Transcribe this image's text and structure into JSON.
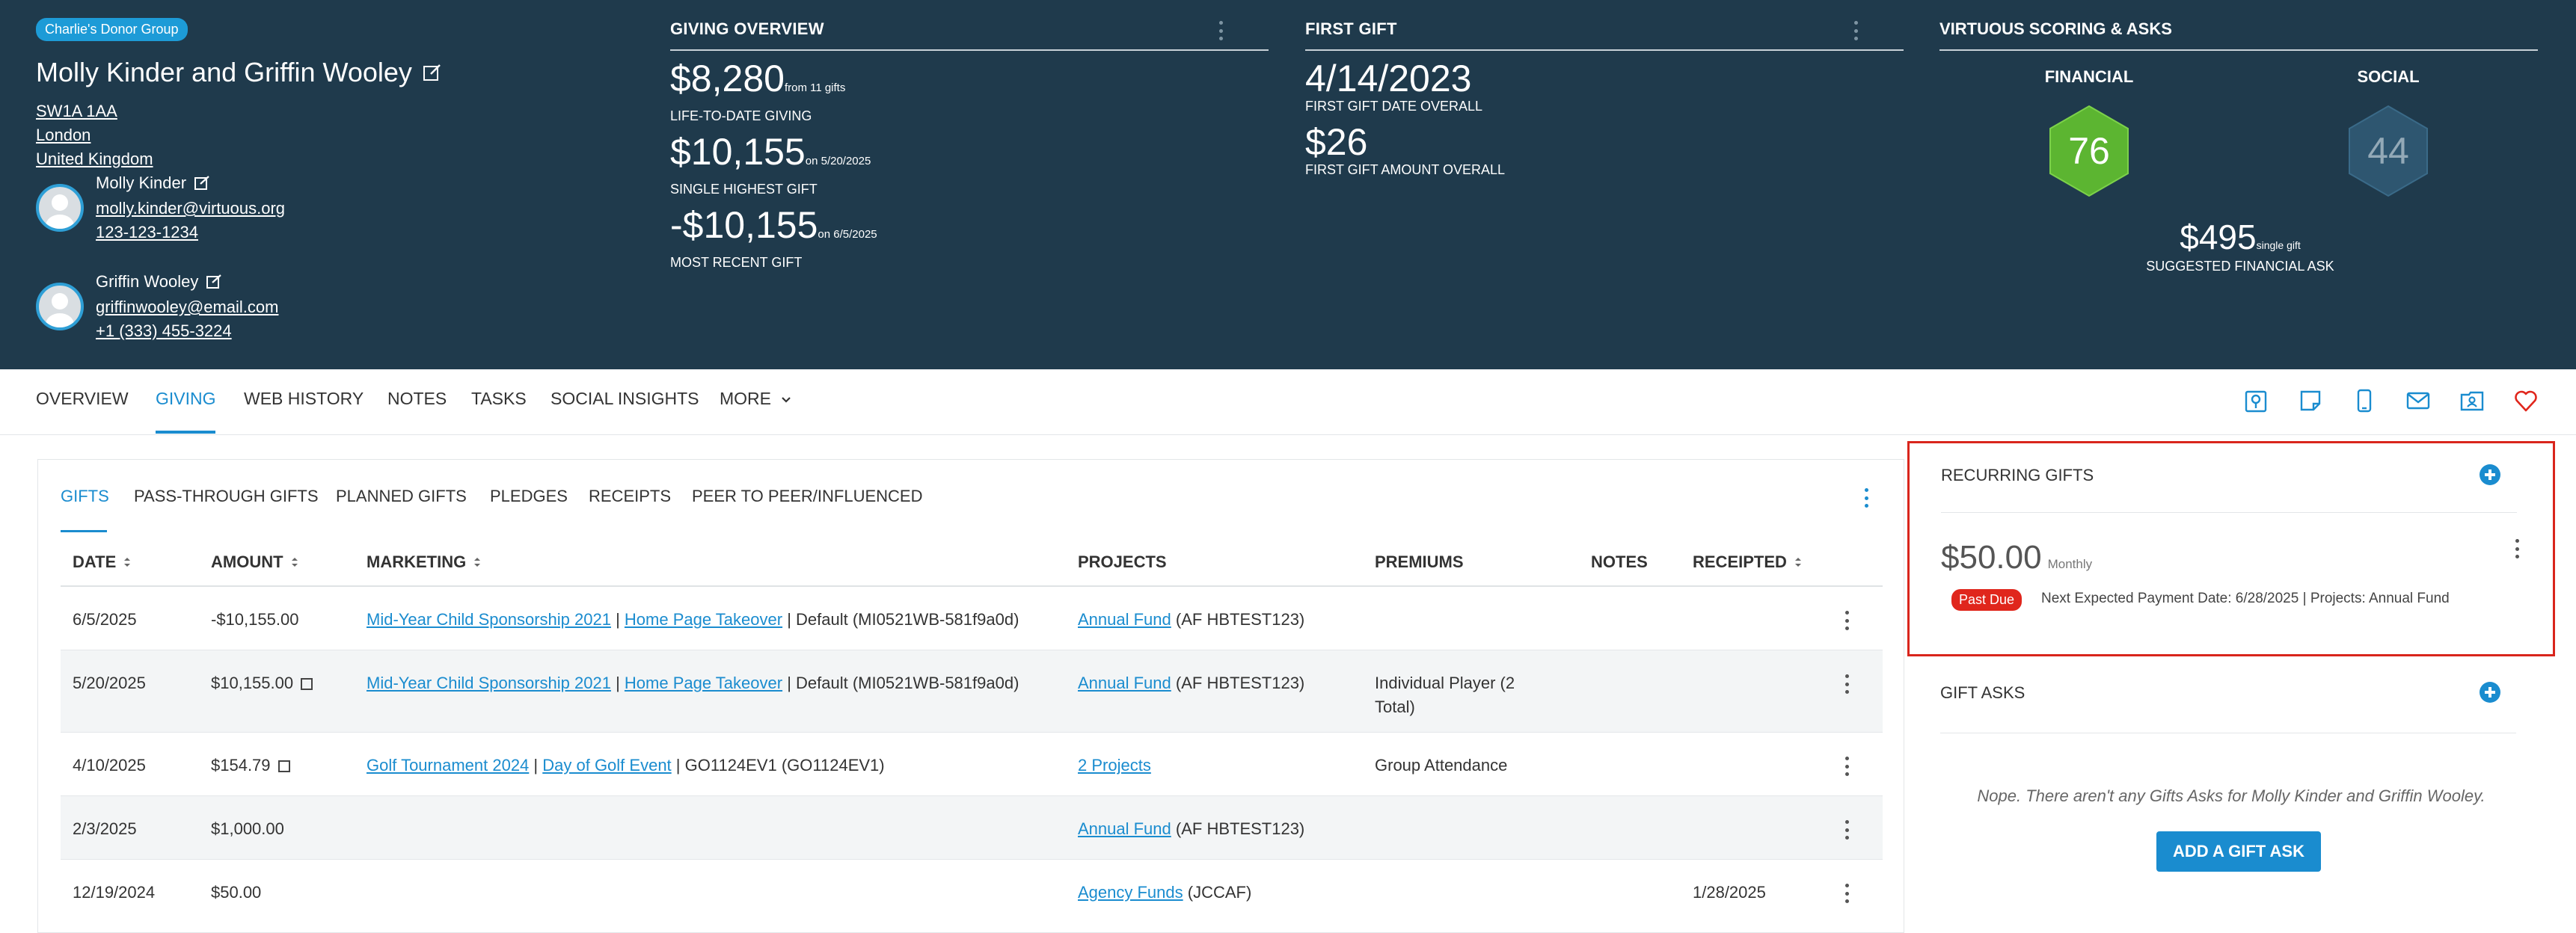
{
  "header": {
    "group_badge": "Charlie's Donor Group",
    "donor_name": "Molly Kinder and Griffin Wooley",
    "address": [
      "SW1A 1AA",
      "London",
      "United Kingdom"
    ],
    "contacts": [
      {
        "name": "Molly Kinder",
        "email": "molly.kinder@virtuous.org",
        "phone": "123-123-1234"
      },
      {
        "name": "Griffin Wooley",
        "email": "griffinwooley@email.com",
        "phone": "+1 (333) 455-3224"
      }
    ]
  },
  "giving_overview": {
    "title": "GIVING OVERVIEW",
    "ltd_value": "$8,280",
    "ltd_note": "from 11 gifts",
    "ltd_label": "LIFE-TO-DATE GIVING",
    "highest_value": "$10,155",
    "highest_note": "on 5/20/2025",
    "highest_label": "SINGLE HIGHEST GIFT",
    "recent_value": "-$10,155",
    "recent_note": "on 6/5/2025",
    "recent_label": "MOST RECENT GIFT"
  },
  "first_gift": {
    "title": "FIRST GIFT",
    "date_value": "4/14/2023",
    "date_label": "FIRST GIFT DATE OVERALL",
    "amount_value": "$26",
    "amount_label": "FIRST GIFT AMOUNT OVERALL"
  },
  "scoring": {
    "title": "VIRTUOUS SCORING & ASKS",
    "financial_label": "FINANCIAL",
    "financial_score": "76",
    "financial_color": "#5cb531",
    "social_label": "SOCIAL",
    "social_score": "44",
    "social_color": "#2e5670",
    "ask_amount": "$495",
    "ask_note": "single gift",
    "ask_label": "SUGGESTED FINANCIAL ASK"
  },
  "nav": {
    "tabs": [
      "OVERVIEW",
      "GIVING",
      "WEB HISTORY",
      "NOTES",
      "TASKS",
      "SOCIAL INSIGHTS",
      "MORE"
    ],
    "active": "GIVING",
    "icons": [
      "map-pin-icon",
      "note-icon",
      "mobile-phone-icon",
      "mail-icon",
      "contact-folder-icon",
      "heart-icon"
    ]
  },
  "gifts": {
    "sub_tabs": [
      "GIFTS",
      "PASS-THROUGH GIFTS",
      "PLANNED GIFTS",
      "PLEDGES",
      "RECEIPTS",
      "PEER TO PEER/INFLUENCED"
    ],
    "columns": [
      "DATE",
      "AMOUNT",
      "MARKETING",
      "PROJECTS",
      "PREMIUMS",
      "NOTES",
      "RECEIPTED"
    ],
    "rows": [
      {
        "date": "6/5/2025",
        "amount": "-$10,155.00",
        "m1": "Mid-Year Child Sponsorship 2021",
        "m2": "Home Page Takeover",
        "m3": "Default (MI0521WB-581f9a0d)",
        "project_link": "Annual Fund",
        "project_code": "(AF HBTEST123)",
        "premium": "",
        "notes": "",
        "receipted": ""
      },
      {
        "date": "5/20/2025",
        "amount": "$10,155.00",
        "m1": "Mid-Year Child Sponsorship 2021",
        "m2": "Home Page Takeover",
        "m3": "Default (MI0521WB-581f9a0d)",
        "project_link": "Annual Fund",
        "project_code": "(AF HBTEST123)",
        "premium": "Individual Player (2 Total)",
        "notes": "",
        "receipted": ""
      },
      {
        "date": "4/10/2025",
        "amount": "$154.79",
        "m1": "Golf Tournament 2024",
        "m2": "Day of Golf Event",
        "m3": "GO1124EV1 (GO1124EV1)",
        "project_link": "2 Projects",
        "project_code": "",
        "premium": "Group Attendance",
        "notes": "",
        "receipted": ""
      },
      {
        "date": "2/3/2025",
        "amount": "$1,000.00",
        "m1": "",
        "m2": "",
        "m3": "",
        "project_link": "Annual Fund",
        "project_code": "(AF HBTEST123)",
        "premium": "",
        "notes": "",
        "receipted": ""
      },
      {
        "date": "12/19/2024",
        "amount": "$50.00",
        "m1": "",
        "m2": "",
        "m3": "",
        "project_link": "Agency Funds",
        "project_code": "(JCCAF)",
        "premium": "",
        "notes": "",
        "receipted": "1/28/2025"
      }
    ]
  },
  "recurring": {
    "title": "RECURRING GIFTS",
    "amount": "$50.00",
    "frequency": "Monthly",
    "status": "Past Due",
    "info": "Next Expected Payment Date: 6/28/2025  | Projects: Annual Fund"
  },
  "gift_asks": {
    "title": "GIFT ASKS",
    "empty_message": "Nope. There aren't any Gifts Asks for Molly Kinder and Griffin Wooley.",
    "add_button": "ADD A GIFT ASK"
  }
}
